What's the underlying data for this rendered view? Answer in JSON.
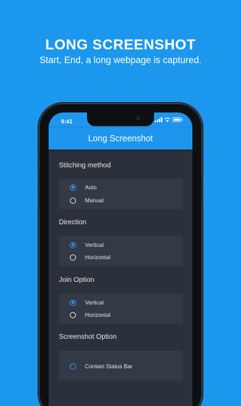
{
  "promo": {
    "title": "LONG SCREENSHOT",
    "subtitle": "Start, End, a long webpage is captured."
  },
  "status_bar": {
    "time": "9:41",
    "icons": [
      "signal-icon",
      "wifi-icon",
      "battery-icon"
    ]
  },
  "app_bar": {
    "title": "Long Screenshot"
  },
  "sections": [
    {
      "label": "Stitching method",
      "options": [
        {
          "label": "Auto",
          "selected": true
        },
        {
          "label": "Manual",
          "selected": false
        }
      ]
    },
    {
      "label": "Direction",
      "options": [
        {
          "label": "Vertical",
          "selected": true
        },
        {
          "label": "Horizontal",
          "selected": false
        }
      ]
    },
    {
      "label": "Join Option",
      "options": [
        {
          "label": "Vertical",
          "selected": true
        },
        {
          "label": "Horizontal",
          "selected": false
        }
      ]
    },
    {
      "label": "Screenshot Option",
      "options": [
        {
          "label": "Contain Status Bar",
          "selected": false
        }
      ]
    }
  ],
  "colors": {
    "background": "#1c97ee",
    "app_bar": "#1e96ee",
    "screen": "#2a313b",
    "card": "#323a45",
    "accent": "#3b9fff"
  }
}
